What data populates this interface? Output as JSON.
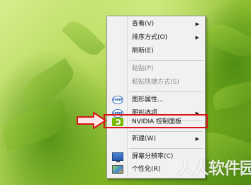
{
  "context_menu": {
    "items": [
      {
        "label": "查看(V)",
        "disabled": false,
        "submenu": true,
        "icon": ""
      },
      {
        "label": "排序方式(O)",
        "disabled": false,
        "submenu": true,
        "icon": ""
      },
      {
        "label": "刷新(E)",
        "disabled": false,
        "submenu": false,
        "icon": ""
      },
      {
        "label": "粘贴(P)",
        "disabled": true,
        "submenu": false,
        "icon": ""
      },
      {
        "label": "粘贴快捷方式(S)",
        "disabled": true,
        "submenu": false,
        "icon": ""
      },
      {
        "label": "图形属性...",
        "disabled": false,
        "submenu": false,
        "icon": "intel-icon"
      },
      {
        "label": "图形选项",
        "disabled": false,
        "submenu": true,
        "icon": "intel-icon"
      },
      {
        "label": "NVIDIA 控制面板",
        "disabled": false,
        "submenu": false,
        "icon": "nvidia-icon",
        "highlighted": true
      },
      {
        "label": "新建(W)",
        "disabled": false,
        "submenu": true,
        "icon": ""
      },
      {
        "label": "屏幕分辨率(C)",
        "disabled": false,
        "submenu": false,
        "icon": "screen-icon"
      },
      {
        "label": "个性化(R)",
        "disabled": false,
        "submenu": false,
        "icon": "personal-icon"
      }
    ],
    "submenu_arrow": "▶",
    "intel_icon_text": "intel"
  },
  "annotation": {
    "highlight_color": "#d9151b",
    "arrow_color": "#d9151b"
  },
  "watermark": {
    "text": "人人软件园"
  }
}
